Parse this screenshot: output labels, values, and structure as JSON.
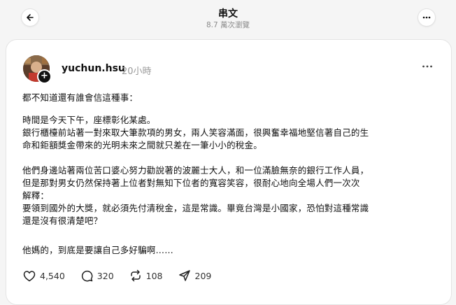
{
  "header": {
    "title": "串文",
    "views": "8.7 萬次瀏覽"
  },
  "post": {
    "username": "yuchun.hsu",
    "time": "20小時",
    "paragraphs": [
      [
        "都不知道還有誰會信這種事："
      ],
      [
        "時間是今天下午，座標彰化某處。",
        "銀行櫃檯前站著一對來取大筆款項的男女，兩人笑容滿面，很興奮幸福地堅信著自己的生",
        "命和鉅額獎金帶來的光明未來之間就只差在一筆小小的稅金。"
      ],
      [
        "他們身邊站著兩位苦口婆心努力勸說著的波麗士大人，和一位滿臉無奈的銀行工作人員，",
        "但是那對男女仍然保持著上位者對無知下位者的寬容笑容，很耐心地向全場人們一次次",
        "解釋：",
        "要領到國外的大獎，就必須先付清稅金，這是常識。畢竟台灣是小國家，恐怕對這種常識",
        "還是沒有很清楚吧？"
      ],
      [
        "他媽的，到底是要讓自己多好騙啊……"
      ]
    ]
  },
  "actions": {
    "likes": "4,540",
    "comments": "320",
    "reposts": "108",
    "shares": "209"
  },
  "icons": [
    "back-arrow-icon",
    "more-icon",
    "plus-icon",
    "heart-icon",
    "comment-icon",
    "repost-icon",
    "share-icon"
  ]
}
